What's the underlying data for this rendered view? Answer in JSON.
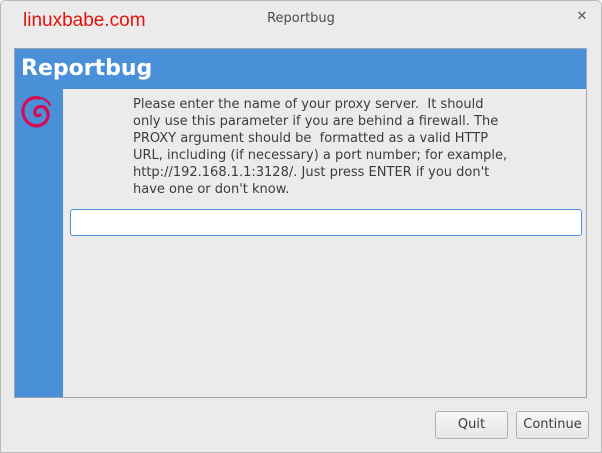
{
  "window": {
    "title": "Reportbug",
    "watermark": "linuxbabe.com",
    "close_glyph": "✕"
  },
  "dialog": {
    "header_title": "Reportbug",
    "logo_icon": "debian-swirl-icon",
    "message": "Please enter the name of your proxy server.  It should\nonly use this parameter if you are behind a firewall. The\nPROXY argument should be  formatted as a valid HTTP\nURL, including (if necessary) a port number; for example,\nhttp://192.168.1.1:3128/. Just press ENTER if you don't\nhave one or don't know.",
    "proxy_input": {
      "value": "",
      "placeholder": ""
    }
  },
  "buttons": {
    "quit_label": "Quit",
    "continue_label": "Continue"
  },
  "colors": {
    "accent": "#4a90d9",
    "watermark": "#e3120b",
    "logo": "#d70a53"
  }
}
